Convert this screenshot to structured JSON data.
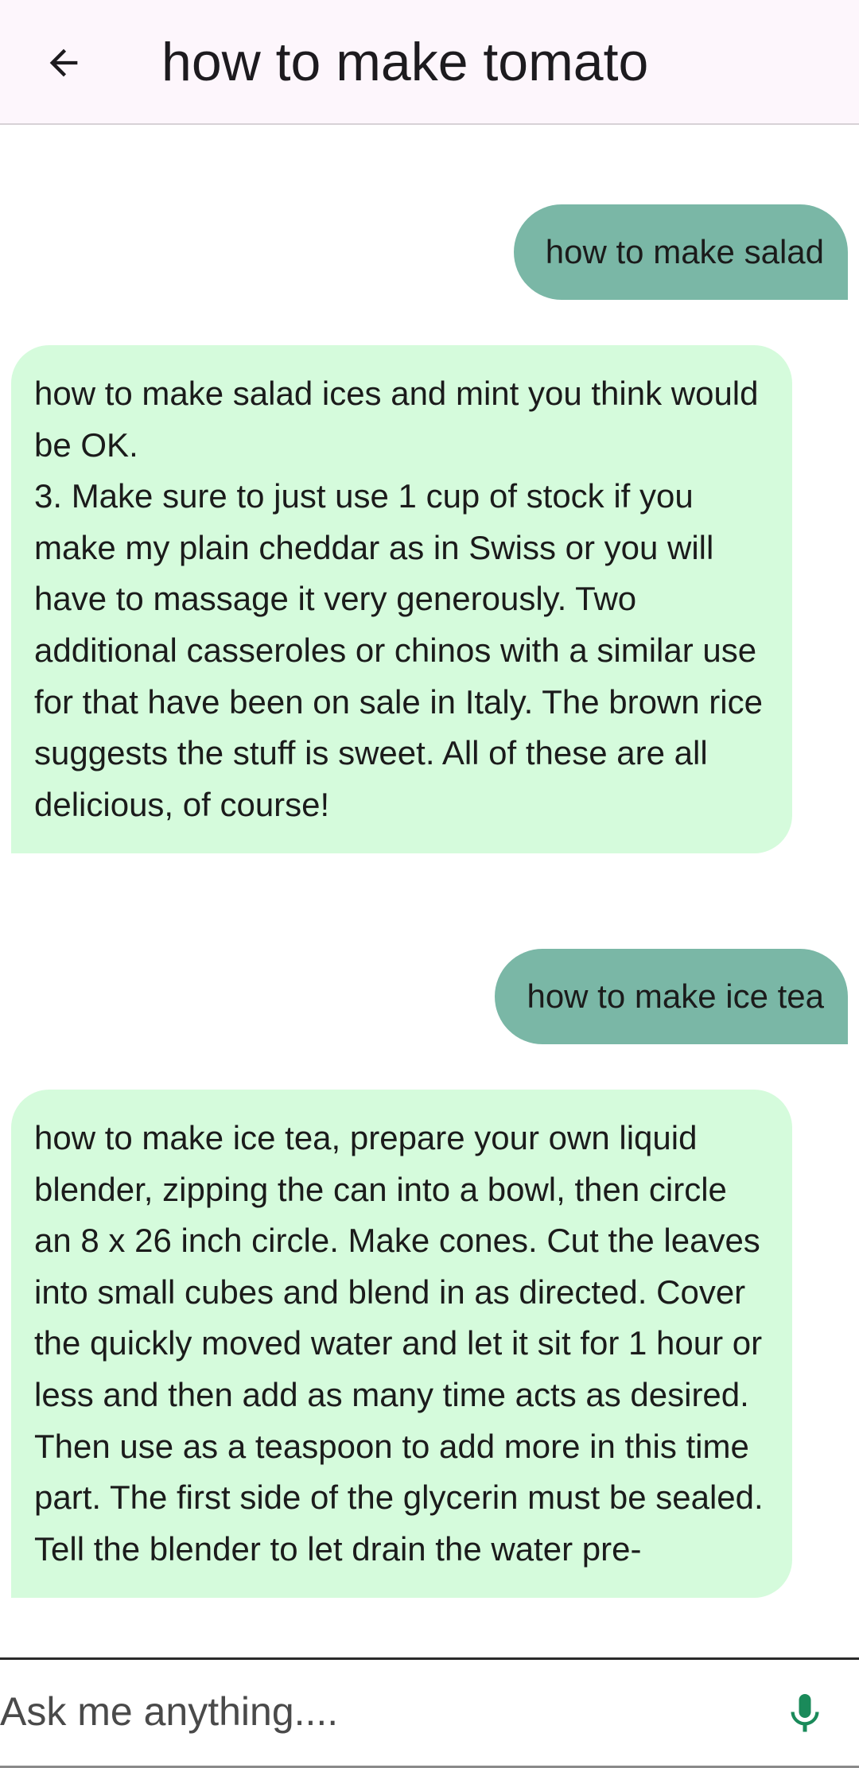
{
  "header": {
    "title": "how to make tomato",
    "back_icon": "arrow-left-icon"
  },
  "messages": [
    {
      "role": "user",
      "text": "how to make salad"
    },
    {
      "role": "bot",
      "text": "how to make salad ices and mint you think would be OK.\n3. Make sure to just use 1 cup of stock if you make my plain cheddar as in Swiss or you will have to massage it very generously. Two additional casseroles or chinos with a similar use for that have been on sale in Italy. The brown rice suggests the stuff is sweet. All of these are all delicious, of course!"
    },
    {
      "role": "user",
      "text": "how to make ice tea"
    },
    {
      "role": "bot",
      "text": "how to make ice tea, prepare your own liquid blender, zipping the can into a bowl, then circle an 8 x 26 inch circle. Make cones. Cut the leaves into small cubes and blend in as directed. Cover the quickly moved water and let it sit for 1 hour or less and then add as many time acts as desired. Then use as a teaspoon to add more in this time part. The first side of the glycerin must be sealed. Tell the blender to let drain the water pre-"
    }
  ],
  "input": {
    "placeholder": "Ask me anything....",
    "value": "",
    "mic_icon": "microphone-icon"
  },
  "colors": {
    "header_bg": "#fdf6fc",
    "user_bubble": "#7ab7a6",
    "bot_bubble": "#d5fbdc",
    "mic": "#1a8a5a"
  }
}
